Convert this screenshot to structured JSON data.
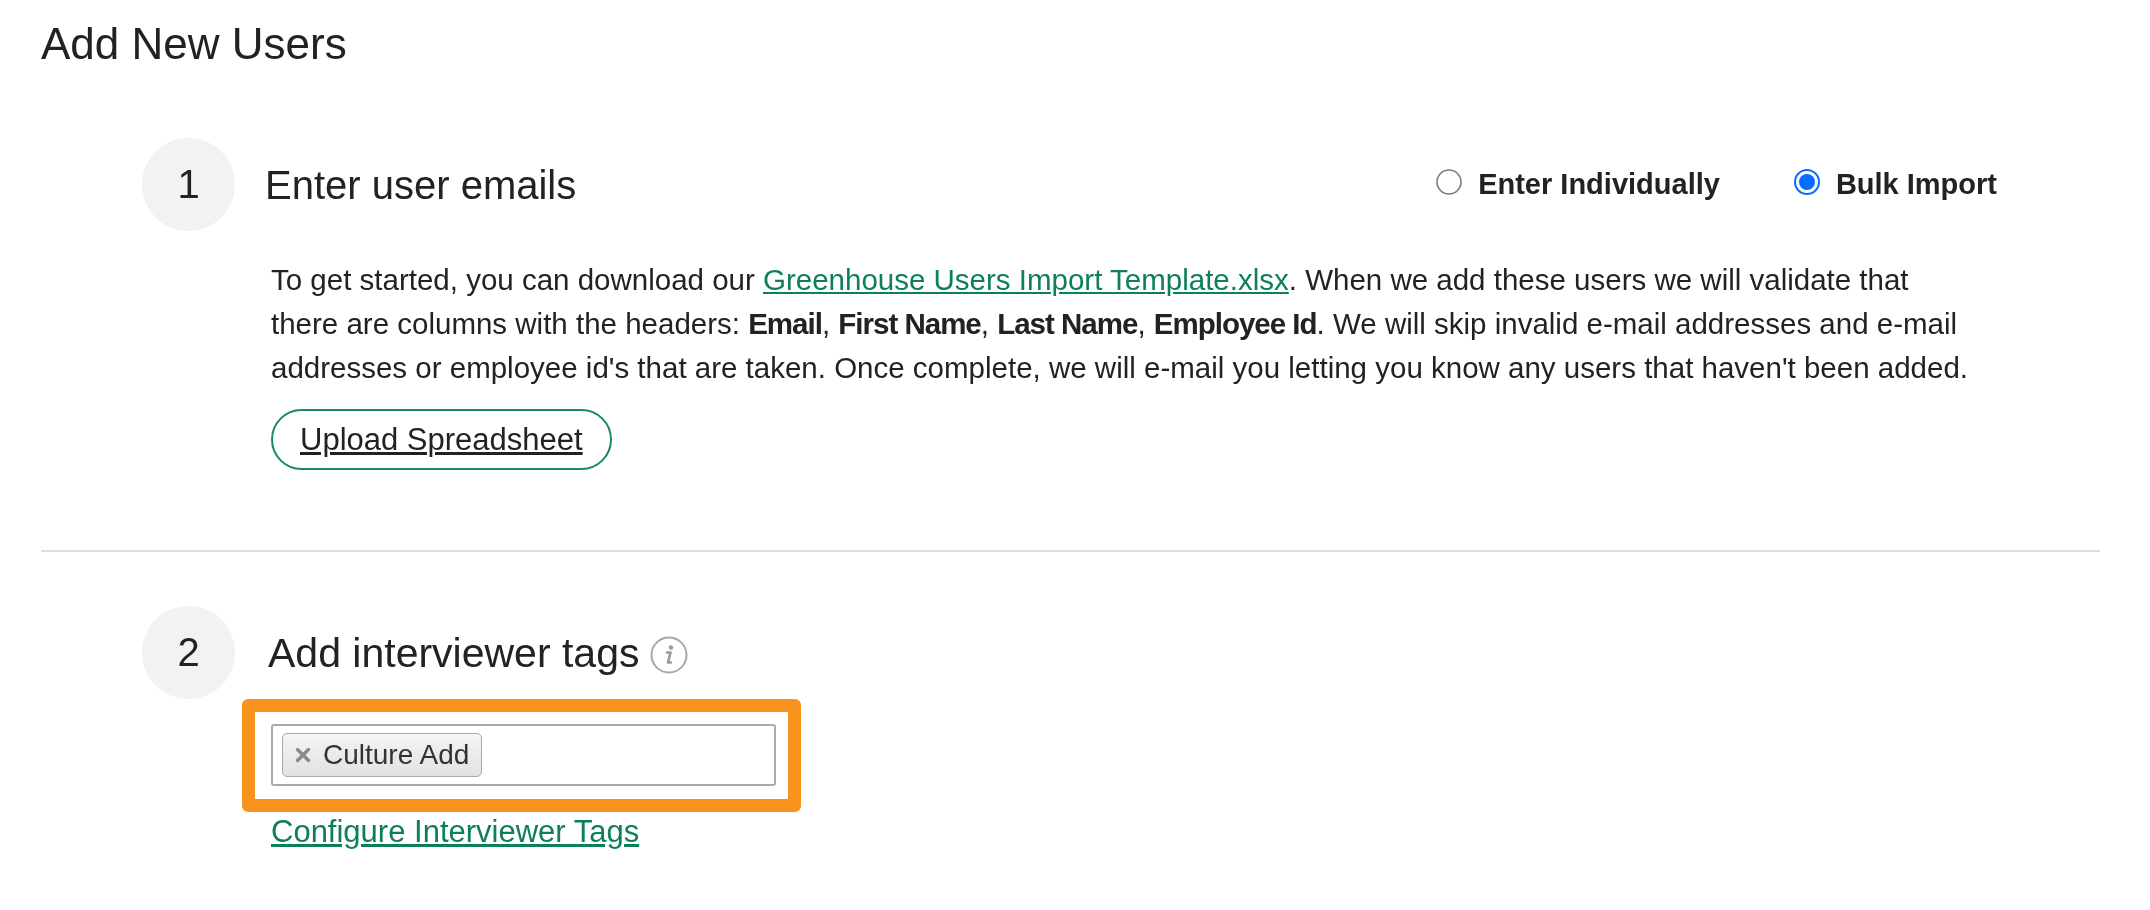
{
  "title": "Add New Users",
  "steps": [
    {
      "number": "1",
      "heading": "Enter user emails",
      "kind": "emails",
      "modes": [
        {
          "label": "Enter Individually",
          "selected": false
        },
        {
          "label": "Bulk Import",
          "selected": true
        }
      ],
      "intro": {
        "before": "To get started, you can download our ",
        "link": "Greenhouse Users Import Template.xlsx",
        "after": ". When we add these users we will validate that there are columns with the headers: **Email**, **First Name**, **Last Name**, **Employee Id**. We will skip invalid e-mail addresses and e-mail addresses or employee id's that are taken. Once complete, we will e-mail you letting you know any users that haven't been added."
      },
      "upload_button": "Upload Spreadsheet"
    },
    {
      "number": "2",
      "heading": "Add interviewer tags",
      "kind": "tags",
      "tags_field": {
        "highlighted": true,
        "tags": [
          "Culture Add"
        ]
      },
      "configure_link": "Configure Interviewer Tags"
    }
  ]
}
